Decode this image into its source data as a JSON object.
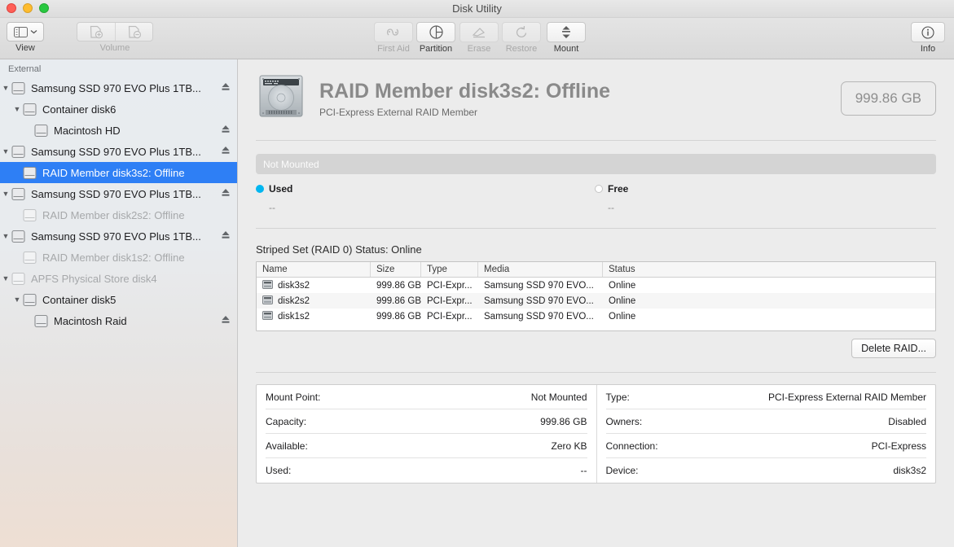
{
  "window": {
    "title": "Disk Utility"
  },
  "toolbar": {
    "view": {
      "label": "View",
      "icon": "sidebar-toggle-icon",
      "chevron": "chevron-down-icon"
    },
    "volume": {
      "label": "Volume",
      "add_icon": "volume-add-icon",
      "remove_icon": "volume-remove-icon",
      "enabled": false
    },
    "actions": [
      {
        "label": "First Aid",
        "icon": "first-aid-icon",
        "enabled": false
      },
      {
        "label": "Partition",
        "icon": "partition-icon",
        "enabled": true
      },
      {
        "label": "Erase",
        "icon": "erase-icon",
        "enabled": false
      },
      {
        "label": "Restore",
        "icon": "restore-icon",
        "enabled": false
      },
      {
        "label": "Mount",
        "icon": "mount-icon",
        "enabled": true
      }
    ],
    "info": {
      "label": "Info",
      "icon": "info-icon"
    }
  },
  "sidebar": {
    "section_header": "External",
    "items": [
      {
        "label": "Samsung SSD 970 EVO Plus 1TB...",
        "indent": 0,
        "twisty": "▼",
        "eject": true,
        "muted": false,
        "selected": false
      },
      {
        "label": "Container disk6",
        "indent": 1,
        "twisty": "▼",
        "eject": false,
        "muted": false,
        "selected": false
      },
      {
        "label": "Macintosh HD",
        "indent": 2,
        "twisty": "",
        "eject": true,
        "muted": false,
        "selected": false
      },
      {
        "label": "Samsung SSD 970 EVO Plus 1TB...",
        "indent": 0,
        "twisty": "▼",
        "eject": true,
        "muted": false,
        "selected": false
      },
      {
        "label": "RAID Member disk3s2: Offline",
        "indent": 1,
        "twisty": "",
        "eject": false,
        "muted": false,
        "selected": true
      },
      {
        "label": "Samsung SSD 970 EVO Plus 1TB...",
        "indent": 0,
        "twisty": "▼",
        "eject": true,
        "muted": false,
        "selected": false
      },
      {
        "label": "RAID Member disk2s2: Offline",
        "indent": 1,
        "twisty": "",
        "eject": false,
        "muted": true,
        "selected": false
      },
      {
        "label": "Samsung SSD 970 EVO Plus 1TB...",
        "indent": 0,
        "twisty": "▼",
        "eject": true,
        "muted": false,
        "selected": false
      },
      {
        "label": "RAID Member disk1s2: Offline",
        "indent": 1,
        "twisty": "",
        "eject": false,
        "muted": true,
        "selected": false
      },
      {
        "label": "APFS Physical Store disk4",
        "indent": 0,
        "twisty": "▼",
        "eject": false,
        "muted": true,
        "selected": false
      },
      {
        "label": "Container disk5",
        "indent": 1,
        "twisty": "▼",
        "eject": false,
        "muted": false,
        "selected": false
      },
      {
        "label": "Macintosh Raid",
        "indent": 2,
        "twisty": "",
        "eject": true,
        "muted": false,
        "selected": false
      }
    ]
  },
  "main": {
    "header": {
      "icon": "hard-drive-icon",
      "title": "RAID Member disk3s2: Offline",
      "subtitle": "PCI-Express External RAID Member",
      "capacity_badge": "999.86 GB"
    },
    "usage": {
      "bar_label": "Not Mounted",
      "legend": [
        {
          "label": "Used",
          "value": "--",
          "color": "#00b6f0"
        },
        {
          "label": "Free",
          "value": "--",
          "color": "#ffffff"
        }
      ]
    },
    "raid": {
      "heading": "Striped Set (RAID 0) Status: Online",
      "columns": [
        "Name",
        "Size",
        "Type",
        "Media",
        "Status"
      ],
      "rows": [
        {
          "name": "disk3s2",
          "size": "999.86 GB",
          "type": "PCI-Expr...",
          "media": "Samsung SSD 970 EVO...",
          "status": "Online"
        },
        {
          "name": "disk2s2",
          "size": "999.86 GB",
          "type": "PCI-Expr...",
          "media": "Samsung SSD 970 EVO...",
          "status": "Online"
        },
        {
          "name": "disk1s2",
          "size": "999.86 GB",
          "type": "PCI-Expr...",
          "media": "Samsung SSD 970 EVO...",
          "status": "Online"
        }
      ],
      "delete_button": "Delete RAID..."
    },
    "info": {
      "left": [
        {
          "label": "Mount Point:",
          "value": "Not Mounted"
        },
        {
          "label": "Capacity:",
          "value": "999.86 GB"
        },
        {
          "label": "Available:",
          "value": "Zero KB"
        },
        {
          "label": "Used:",
          "value": "--"
        }
      ],
      "right": [
        {
          "label": "Type:",
          "value": "PCI-Express External RAID Member"
        },
        {
          "label": "Owners:",
          "value": "Disabled"
        },
        {
          "label": "Connection:",
          "value": "PCI-Express"
        },
        {
          "label": "Device:",
          "value": "disk3s2"
        }
      ]
    }
  }
}
